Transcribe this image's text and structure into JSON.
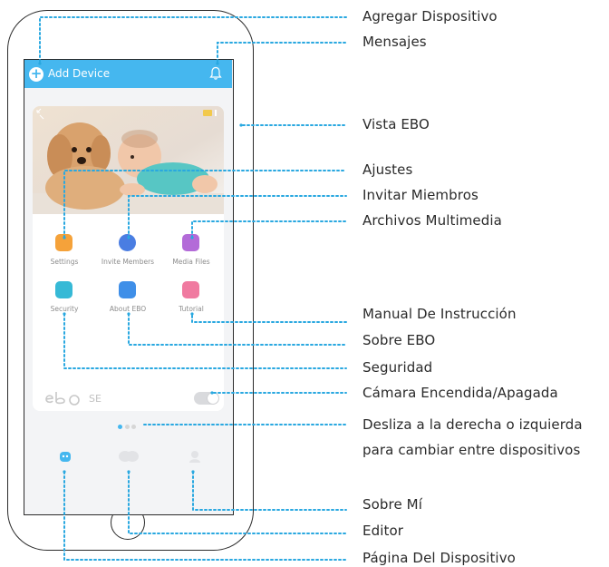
{
  "app": {
    "add_device_label": "Add Device",
    "menu": [
      {
        "label": "Settings",
        "icon": "settings-icon",
        "color": "#f5a23a"
      },
      {
        "label": "Invite Members",
        "icon": "invite-members-icon",
        "color": "#4a7de2"
      },
      {
        "label": "Media Files",
        "icon": "media-files-icon",
        "color": "#b36bd8"
      },
      {
        "label": "Security",
        "icon": "security-icon",
        "color": "#36b9d6"
      },
      {
        "label": "About EBO",
        "icon": "about-ebo-icon",
        "color": "#3f8fe8"
      },
      {
        "label": "Tutorial",
        "icon": "tutorial-icon",
        "color": "#f07aa0"
      }
    ],
    "model_suffix": "SE",
    "accent": "#45b7ef"
  },
  "callouts": {
    "add_device": "Agregar Dispositivo",
    "messages": "Mensajes",
    "ebo_view": "Vista EBO",
    "settings": "Ajustes",
    "invite_members": "Invitar Miembros",
    "media_files": "Archivos Multimedia",
    "tutorial": "Manual De Instrucción",
    "about_ebo": "Sobre EBO",
    "security": "Seguridad",
    "camera_toggle": "Cámara Encendida/Apagada",
    "swipe_line1": "Desliza a la derecha o izquierda",
    "swipe_line2": "para cambiar entre dispositivos",
    "about_me": "Sobre Mí",
    "editor": "Editor",
    "device_page": "Página Del Dispositivo"
  },
  "line_color": "#29a8e0"
}
